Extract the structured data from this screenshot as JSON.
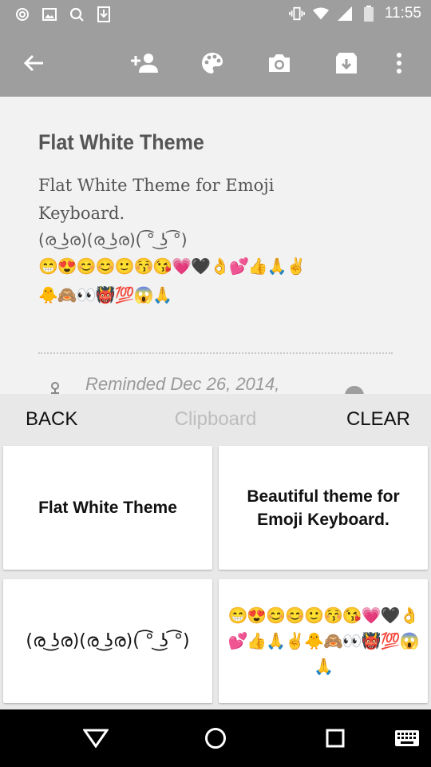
{
  "status_bar": {
    "time": "11:55",
    "left_icons": [
      "at-sign-icon",
      "image-icon",
      "search-icon",
      "download-icon"
    ],
    "right_icons": [
      "vibrate-icon",
      "wifi-icon",
      "signal-icon",
      "battery-icon"
    ]
  },
  "toolbar": {
    "icons": [
      "back-arrow-icon",
      "add-person-icon",
      "palette-icon",
      "camera-icon",
      "archive-icon",
      "more-vert-icon"
    ]
  },
  "note": {
    "title": "Flat White Theme",
    "body_line1": "Flat White Theme for Emoji",
    "body_line2": "Keyboard.",
    "kaomoji": "(ര ͜ʖര)(ര ͜ʖര)( ͡° ͜ʖ ͡°)",
    "emoji_line1": "😁😍😊😊🙂😚😘💗🖤👌💕👍🙏✌",
    "emoji_line2": "🐥🙈👀👹💯😱🙏",
    "reminder": "Reminded Dec 26, 2014,"
  },
  "clipboard": {
    "back_label": "BACK",
    "title": "Clipboard",
    "clear_label": "CLEAR",
    "items": [
      {
        "text": "Flat White Theme"
      },
      {
        "text": "Beautiful theme for Emoji Keyboard."
      },
      {
        "text": "(ര ͜ʖര)(ര ͜ʖര)( ͡° ͜ʖ ͡°)"
      },
      {
        "text": "😁😍😊😊🙂😚😘💗🖤👌💕👍🙏✌🐥🙈👀👹💯😱🙏"
      }
    ]
  },
  "nav_bar": {
    "icons": [
      "back-triangle-icon",
      "home-circle-icon",
      "recents-square-icon",
      "keyboard-icon"
    ]
  },
  "colors": {
    "app_bar": "#9e9e9e",
    "background": "#f2f2f2",
    "clipboard_panel": "#e8e8e8",
    "nav_bar": "#000000"
  }
}
